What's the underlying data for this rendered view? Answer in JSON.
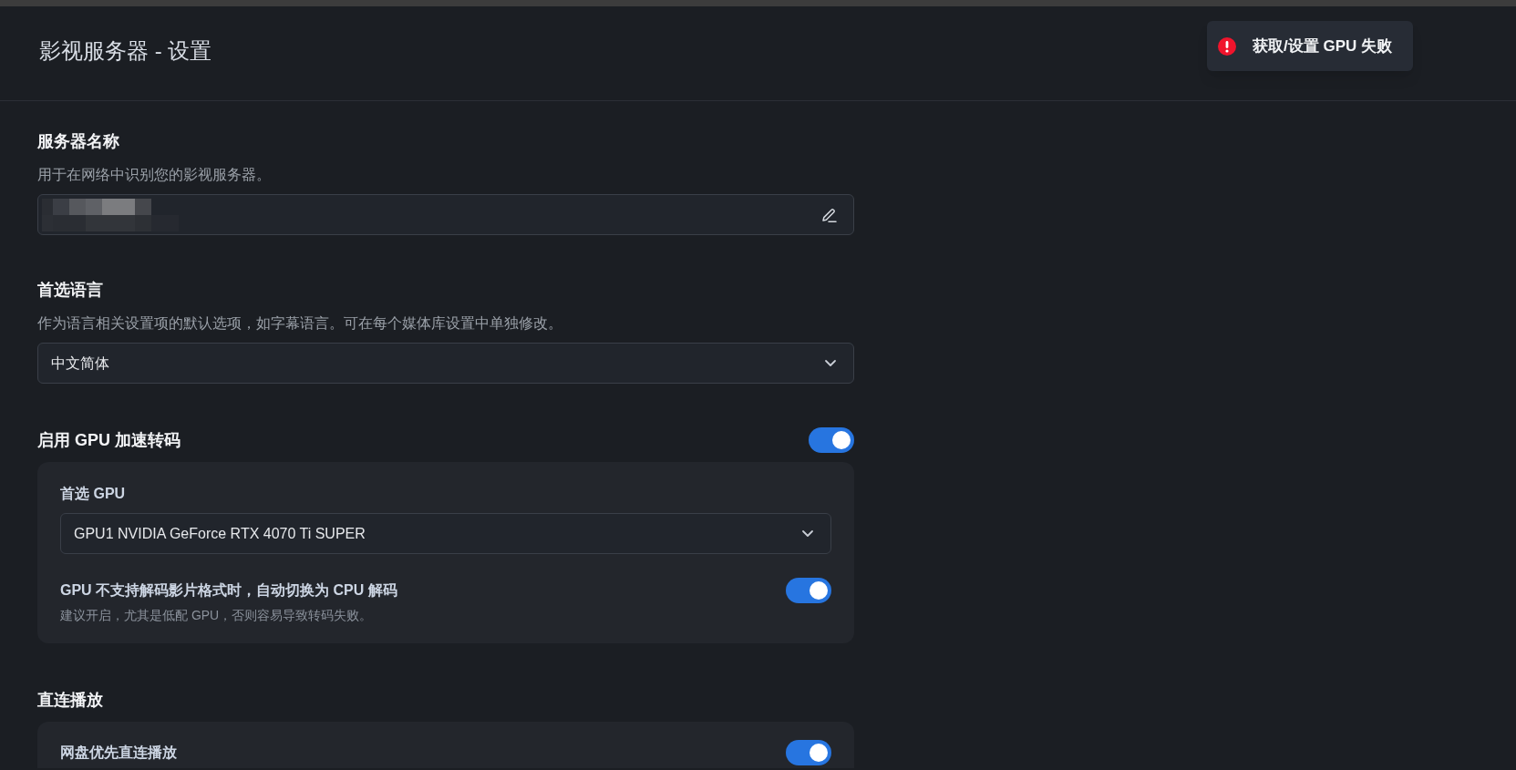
{
  "window": {
    "title": "影视服务器 - 设置"
  },
  "toast": {
    "kind": "error",
    "message": "获取/设置 GPU 失败"
  },
  "sections": [
    {
      "kind": "text_field",
      "title": "服务器名称",
      "description": "用于在网络中识别您的影视服务器。"
    },
    {
      "kind": "select",
      "title": "首选语言",
      "description": "作为语言相关设置项的默认选项，如字幕语言。可在每个媒体库设置中单独修改。",
      "value": "中文简体"
    },
    {
      "kind": "toggle_group",
      "title": "启用 GPU 加速转码",
      "on": true,
      "items": [
        {
          "kind": "select",
          "label": "首选 GPU",
          "value": "GPU1 NVIDIA GeForce RTX 4070 Ti SUPER"
        },
        {
          "kind": "toggle",
          "label": "GPU 不支持解码影片格式时，自动切换为 CPU 解码",
          "hint": "建议开启，尤其是低配 GPU，否则容易导致转码失败。",
          "on": true
        }
      ]
    },
    {
      "kind": "group",
      "title": "直连播放",
      "items": [
        {
          "kind": "toggle",
          "label": "网盘优先直连播放",
          "on": true
        }
      ]
    }
  ]
}
